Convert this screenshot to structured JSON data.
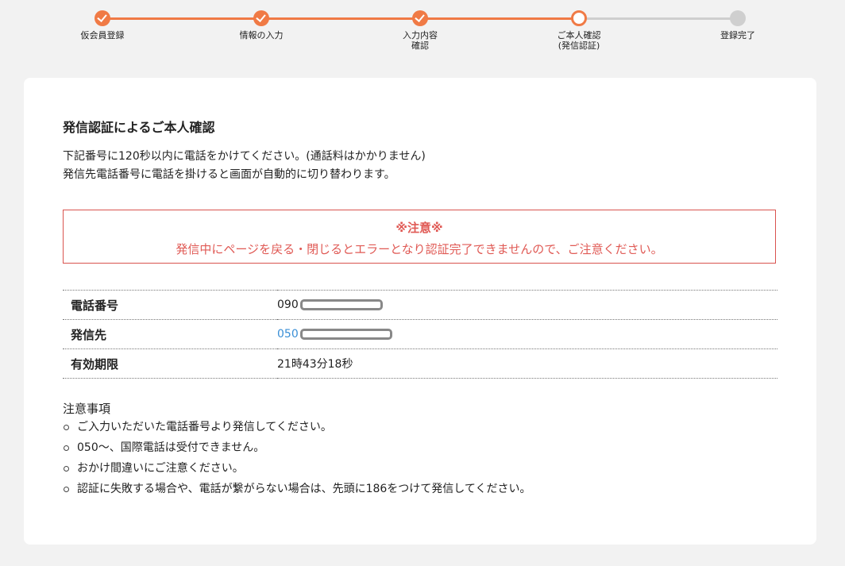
{
  "steps": [
    {
      "label": "仮会員登録",
      "state": "done"
    },
    {
      "label": "情報の入力",
      "state": "done"
    },
    {
      "label": "入力内容\n確認",
      "state": "done"
    },
    {
      "label": "ご本人確認\n(発信認証)",
      "state": "current"
    },
    {
      "label": "登録完了",
      "state": "todo"
    }
  ],
  "main": {
    "heading": "発信認証によるご本人確認",
    "intro_line1": "下記番号に120秒以内に電話をかけてください。(通話料はかかりません)",
    "intro_line2": "発信先電話番号に電話を掛けると画面が自動的に切り替わります。"
  },
  "notice": {
    "title": "※注意※",
    "text": "発信中にページを戻る・閉じるとエラーとなり認証完了できませんので、ご注意ください。"
  },
  "info": {
    "phone_label": "電話番号",
    "phone_value": "090",
    "dest_label": "発信先",
    "dest_value": "050",
    "expiry_label": "有効期限",
    "expiry_value": "21時43分18秒"
  },
  "notes": {
    "title": "注意事項",
    "items": [
      "ご入力いただいた電話番号より発信してください。",
      "050～、国際電話は受付できません。",
      "おかけ間違いにご注意ください。",
      "認証に失敗する場合や、電話が繋がらない場合は、先頭に186をつけて発信してください。"
    ]
  },
  "colors": {
    "accent": "#f07a45",
    "inactive": "#cfcfcf",
    "warning": "#e05a55",
    "link": "#3a8fd6"
  }
}
